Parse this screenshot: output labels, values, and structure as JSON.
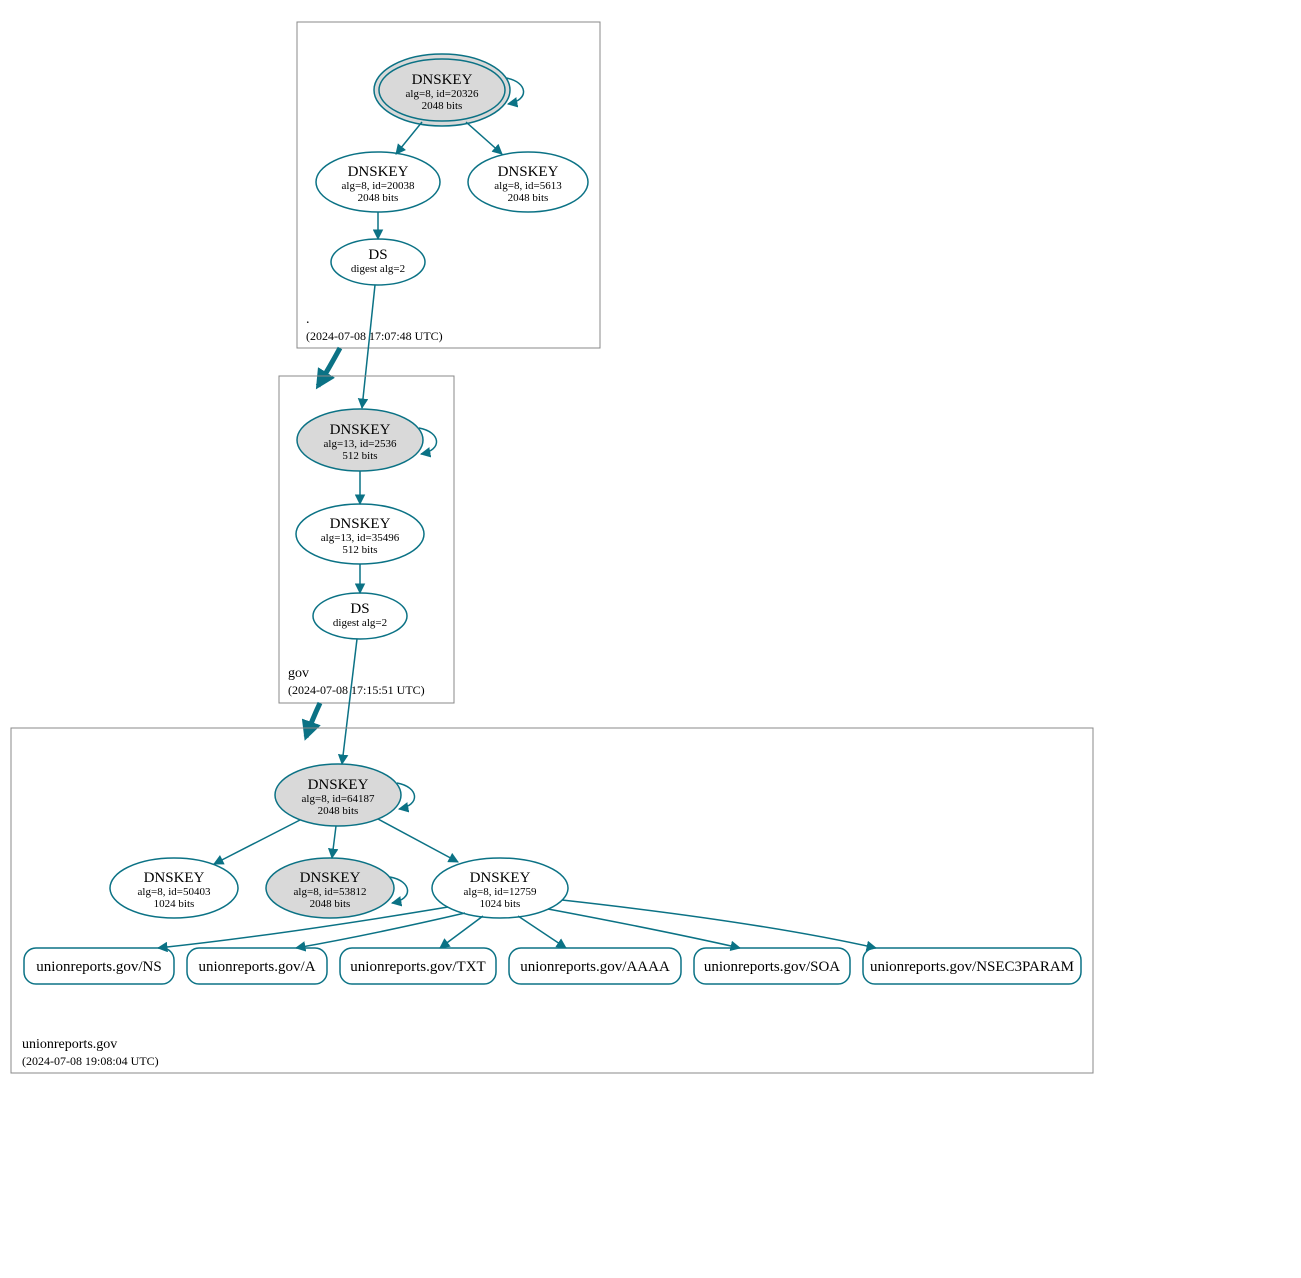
{
  "zones": {
    "root": {
      "name": ".",
      "timestamp": "(2024-07-08 17:07:48 UTC)"
    },
    "gov": {
      "name": "gov",
      "timestamp": "(2024-07-08 17:15:51 UTC)"
    },
    "domain": {
      "name": "unionreports.gov",
      "timestamp": "(2024-07-08 19:08:04 UTC)"
    }
  },
  "nodes": {
    "root_ksk": {
      "title": "DNSKEY",
      "line1": "alg=8, id=20326",
      "line2": "2048 bits"
    },
    "root_zsk": {
      "title": "DNSKEY",
      "line1": "alg=8, id=20038",
      "line2": "2048 bits"
    },
    "root_key3": {
      "title": "DNSKEY",
      "line1": "alg=8, id=5613",
      "line2": "2048 bits"
    },
    "root_ds": {
      "title": "DS",
      "line1": "digest alg=2"
    },
    "gov_ksk": {
      "title": "DNSKEY",
      "line1": "alg=13, id=2536",
      "line2": "512 bits"
    },
    "gov_zsk": {
      "title": "DNSKEY",
      "line1": "alg=13, id=35496",
      "line2": "512 bits"
    },
    "gov_ds": {
      "title": "DS",
      "line1": "digest alg=2"
    },
    "dom_ksk": {
      "title": "DNSKEY",
      "line1": "alg=8, id=64187",
      "line2": "2048 bits"
    },
    "dom_key2": {
      "title": "DNSKEY",
      "line1": "alg=8, id=50403",
      "line2": "1024 bits"
    },
    "dom_key3": {
      "title": "DNSKEY",
      "line1": "alg=8, id=53812",
      "line2": "2048 bits"
    },
    "dom_key4": {
      "title": "DNSKEY",
      "line1": "alg=8, id=12759",
      "line2": "1024 bits"
    }
  },
  "records": {
    "ns": "unionreports.gov/NS",
    "a": "unionreports.gov/A",
    "txt": "unionreports.gov/TXT",
    "aaaa": "unionreports.gov/AAAA",
    "soa": "unionreports.gov/SOA",
    "nsec": "unionreports.gov/NSEC3PARAM"
  }
}
